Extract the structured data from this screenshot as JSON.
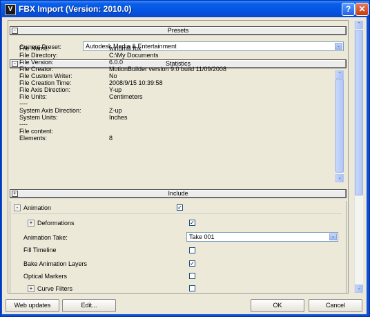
{
  "window": {
    "title": "FBX Import (Version: 2010.0)",
    "icon_letter": "V"
  },
  "presets": {
    "header": "Presets",
    "current_label": "Current Preset:",
    "current_value": "Autodesk Media & Entertainment"
  },
  "statistics": {
    "header": "Statistics",
    "rows": [
      {
        "label": "File Name:",
        "value": "windmill.fbx"
      },
      {
        "label": "File Directory:",
        "value": "C:\\My Documents"
      },
      {
        "label": "File Version:",
        "value": "6.0.0"
      },
      {
        "label": "File Creator:",
        "value": "MotionBuilder version 9.0 build 11/09/2008"
      },
      {
        "label": "File Custom Writer:",
        "value": "No"
      },
      {
        "label": "File Creation Time:",
        "value": "2008/9/15  10:39:58"
      },
      {
        "label": "File Axis Direction:",
        "value": "Y-up"
      },
      {
        "label": "File Units:",
        "value": "Centimeters"
      },
      {
        "label": "----",
        "value": ""
      },
      {
        "label": "System Axis Direction:",
        "value": "Z-up"
      },
      {
        "label": "System Units:",
        "value": "Inches"
      },
      {
        "label": "----",
        "value": ""
      },
      {
        "label": "File content:",
        "value": ""
      },
      {
        "label": "Elements:",
        "value": "8"
      }
    ]
  },
  "include": {
    "header": "Include",
    "animation_label": "Animation",
    "animation_checked": true,
    "deformations_label": "Deformations",
    "deformations_checked": true,
    "take_label": "Animation Take:",
    "take_value": "Take 001",
    "fill_timeline_label": "Fill Timeline",
    "fill_timeline_checked": false,
    "bake_label": "Bake Animation Layers",
    "bake_checked": true,
    "optical_label": "Optical Markers",
    "optical_checked": false,
    "curve_filters_label": "Curve Filters",
    "curve_filters_checked": false
  },
  "buttons": {
    "web_updates": "Web updates",
    "edit": "Edit...",
    "ok": "OK",
    "cancel": "Cancel"
  },
  "glyphs": {
    "minus": "-",
    "plus": "+",
    "check": "✓",
    "down": "⌄",
    "up": "⌃"
  }
}
